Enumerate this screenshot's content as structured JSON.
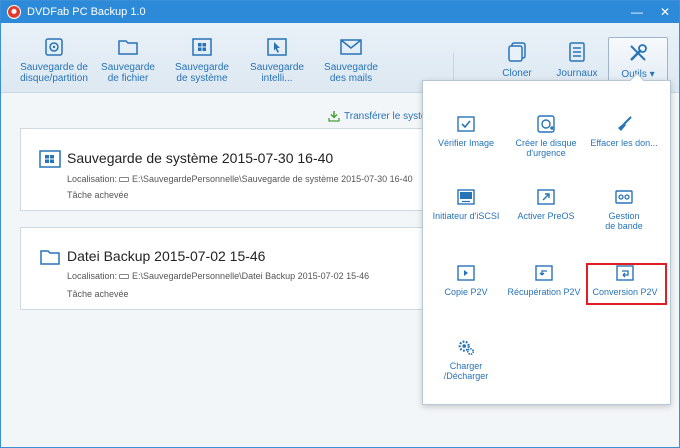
{
  "window": {
    "title": "DVDFab PC Backup 1.0",
    "min_label": "—",
    "close_label": "✕"
  },
  "toolbar": {
    "items": [
      {
        "label1": "Sauvegarde de",
        "label2": "disque/partition"
      },
      {
        "label1": "Sauvegarde",
        "label2": "de fichier"
      },
      {
        "label1": "Sauvegarde",
        "label2": "de système"
      },
      {
        "label1": "Sauvegarde intelli...",
        "label2": ""
      },
      {
        "label1": "Sauvegarde",
        "label2": "des mails"
      }
    ],
    "right": [
      {
        "label": "Cloner"
      },
      {
        "label": "Journaux"
      },
      {
        "label": "Outils ▾"
      }
    ]
  },
  "transfer": {
    "label": "Transférer le système"
  },
  "cards": [
    {
      "title": "Sauvegarde de système 2015-07-30 16-40",
      "loc_label": "Localisation:",
      "loc_value": "E:\\SauvegardePersonnelle\\Sauvegarde de système 2015-07-30 16-40",
      "status": "Tâche achevée"
    },
    {
      "title": "Datei Backup 2015-07-02 15-46",
      "loc_label": "Localisation:",
      "loc_value": "E:\\SauvegardePersonnelle\\Datei Backup 2015-07-02 15-46",
      "status": "Tâche achevée"
    }
  ],
  "menu": {
    "items": [
      {
        "label1": "Vérifier Image",
        "label2": "",
        "label3": ""
      },
      {
        "label1": "Créer le disque",
        "label2": "d'urgence",
        "label3": ""
      },
      {
        "label1": "Effacer les don...",
        "label2": "",
        "label3": ""
      },
      {
        "label1": "Initiateur d'iSCSI",
        "label2": "",
        "label3": ""
      },
      {
        "label1": "Activer PreOS",
        "label2": "",
        "label3": ""
      },
      {
        "label1": "Gestion",
        "label2": "de bande",
        "label3": ""
      },
      {
        "label1": "Copie P2V",
        "label2": "",
        "label3": ""
      },
      {
        "label1": "Récupération P2V",
        "label2": "",
        "label3": ""
      },
      {
        "label1": "Conversion P2V",
        "label2": "",
        "label3": ""
      },
      {
        "label1": "Charger",
        "label2": "/Décharger",
        "label3": ""
      }
    ]
  },
  "colors": {
    "accent": "#2d8ad8",
    "link": "#2773b8",
    "highlight": "#e02020"
  }
}
